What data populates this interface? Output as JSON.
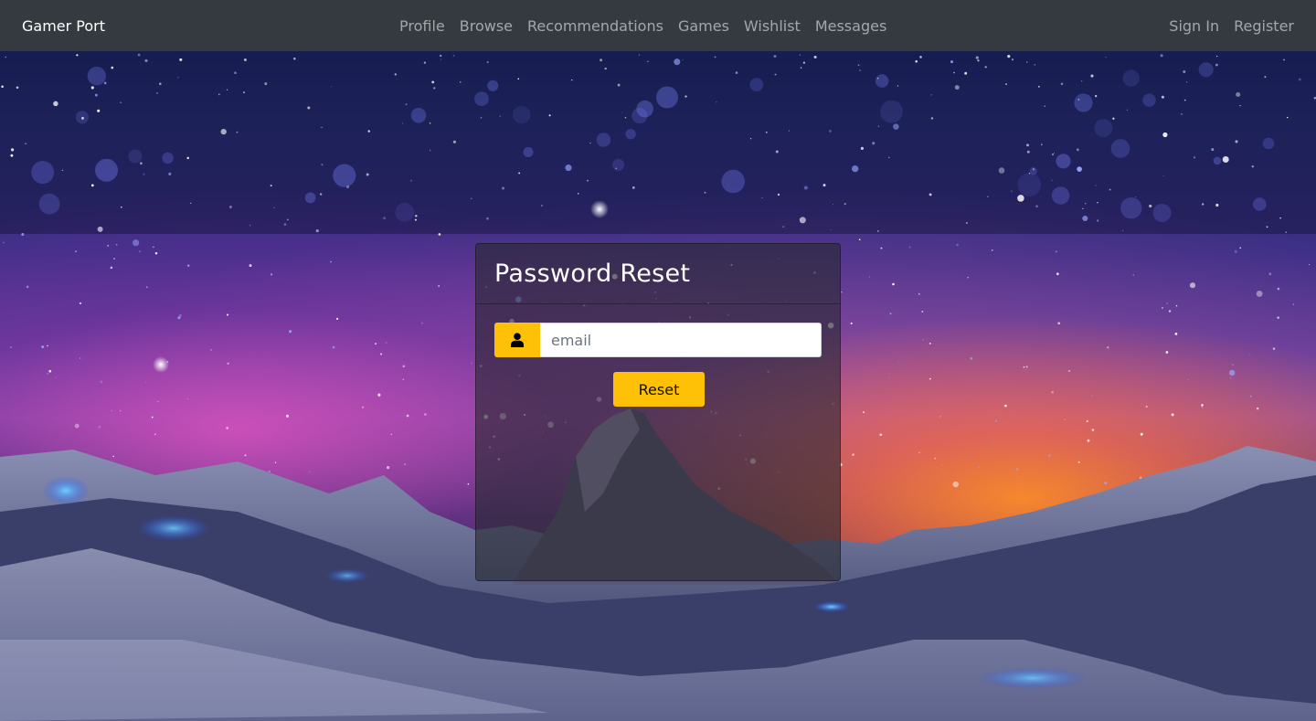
{
  "navbar": {
    "brand": "Gamer Port",
    "links": [
      "Profile",
      "Browse",
      "Recommendations",
      "Games",
      "Wishlist",
      "Messages"
    ],
    "auth_links": [
      "Sign In",
      "Register"
    ],
    "background_color": "#343a40"
  },
  "reset_card": {
    "title": "Password Reset",
    "email_placeholder": "email",
    "email_value": "",
    "submit_label": "Reset",
    "accent_color": "#ffc107",
    "input_icon": "user-icon"
  },
  "background": {
    "description_icon": "starry-mountain-night-sky"
  }
}
